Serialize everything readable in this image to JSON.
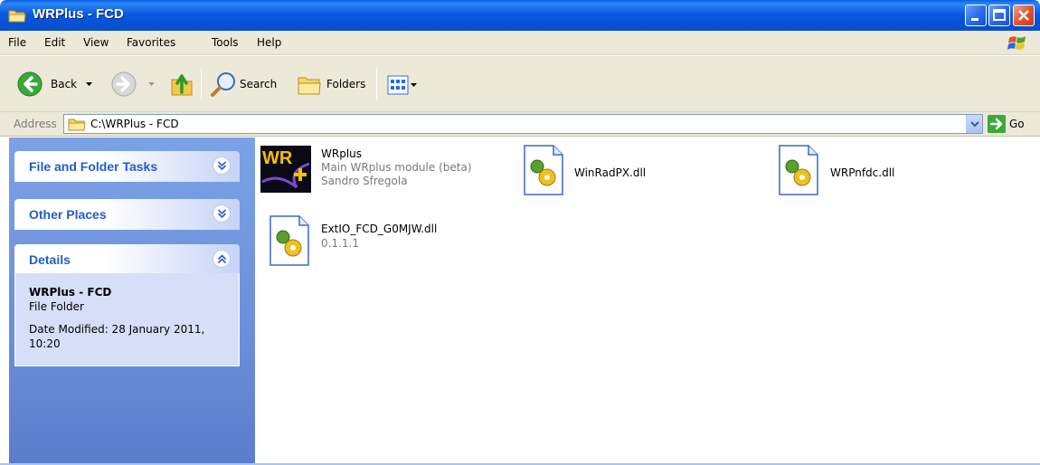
{
  "window": {
    "title": "WRPlus - FCD"
  },
  "menu": [
    "File",
    "Edit",
    "View",
    "Favorites",
    "Tools",
    "Help"
  ],
  "toolbar": {
    "back": "Back",
    "search": "Search",
    "folders": "Folders"
  },
  "address": {
    "label": "Address",
    "path": "C:\\WRPlus - FCD",
    "go": "Go"
  },
  "sidebar": {
    "panels": [
      {
        "title": "File and Folder Tasks",
        "state": "collapsed"
      },
      {
        "title": "Other Places",
        "state": "collapsed"
      },
      {
        "title": "Details",
        "state": "expanded"
      }
    ],
    "details": {
      "name": "WRPlus - FCD",
      "type": "File Folder",
      "modified": "Date Modified: 28 January 2011, 10:20"
    }
  },
  "files": [
    {
      "name": "WRplus",
      "line2": "Main WRplus module (beta)",
      "line3": "Sandro Sfregola",
      "icon": "wrplus-app-icon"
    },
    {
      "name": "WinRadPX.dll",
      "icon": "dll-file-icon"
    },
    {
      "name": "WRPnfdc.dll",
      "icon": "dll-file-icon"
    },
    {
      "name": "ExtIO_FCD_G0MJW.dll",
      "line2": "0.1.1.1",
      "icon": "dll-file-icon"
    }
  ],
  "colors": {
    "titlebar": "#0a5fe4",
    "sidebar": "#7ba2e7",
    "panel_title": "#215dc6",
    "chrome": "#ece9d8"
  }
}
